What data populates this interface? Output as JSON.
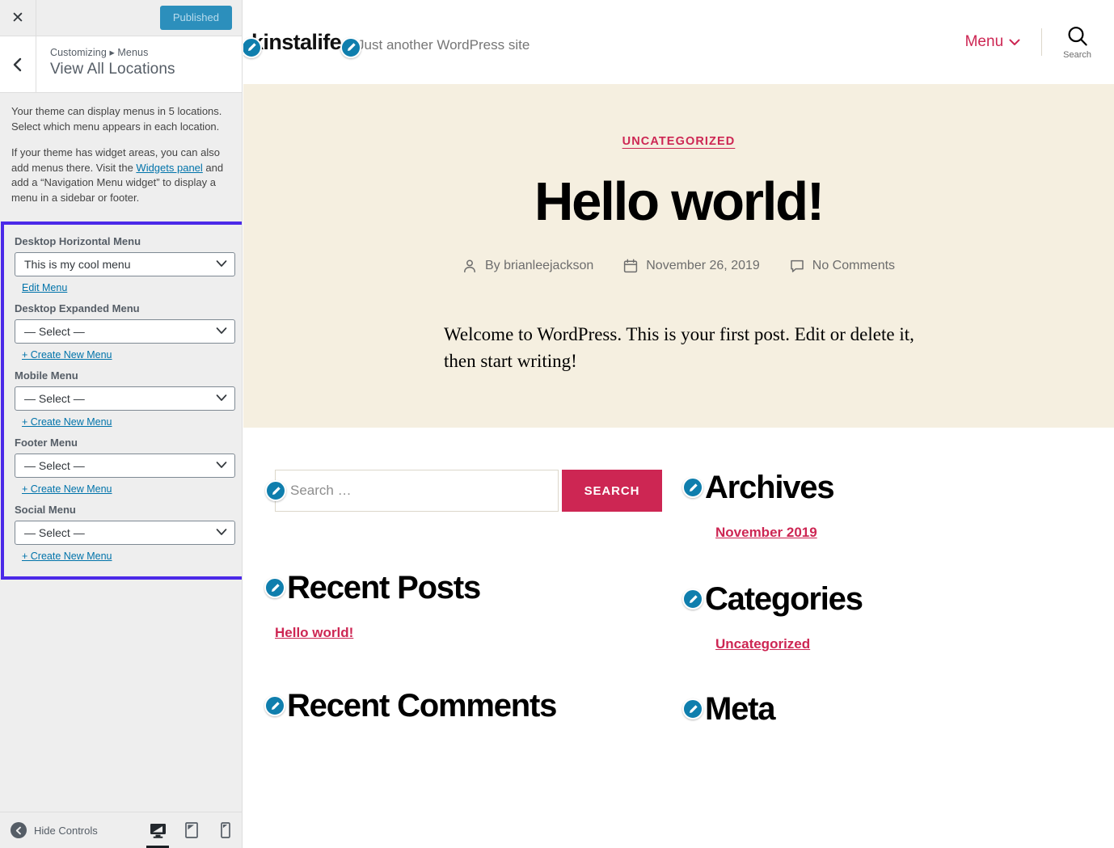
{
  "customizer": {
    "close_icon": "close-x-icon",
    "publish_button": "Published",
    "back_icon": "chevron-left-icon",
    "breadcrumb": "Customizing ▸ Menus",
    "panel_title": "View All Locations",
    "intro_paragraph_1": "Your theme can display menus in 5 locations. Select which menu appears in each location.",
    "intro_paragraph_2_before": "If your theme has widget areas, you can also add menus there. Visit the ",
    "intro_link": "Widgets panel",
    "intro_paragraph_2_after": " and add a “Navigation Menu widget” to display a menu in a sidebar or footer.",
    "highlight_color": "#4b29e8",
    "locations": [
      {
        "label": "Desktop Horizontal Menu",
        "selected": "This is my cool menu",
        "action_link": "Edit Menu"
      },
      {
        "label": "Desktop Expanded Menu",
        "selected": "— Select —",
        "action_link": "+ Create New Menu"
      },
      {
        "label": "Mobile Menu",
        "selected": "— Select —",
        "action_link": "+ Create New Menu"
      },
      {
        "label": "Footer Menu",
        "selected": "— Select —",
        "action_link": "+ Create New Menu"
      },
      {
        "label": "Social Menu",
        "selected": "— Select —",
        "action_link": "+ Create New Menu"
      }
    ],
    "footer": {
      "hide_controls": "Hide Controls",
      "devices": [
        {
          "name": "desktop-preview",
          "icon": "desktop-icon",
          "active": true
        },
        {
          "name": "tablet-preview",
          "icon": "tablet-icon",
          "active": false
        },
        {
          "name": "mobile-preview",
          "icon": "mobile-icon",
          "active": false
        }
      ]
    }
  },
  "preview": {
    "header": {
      "site_title": "kinstalife",
      "tagline": "Just another WordPress site",
      "menu_label": "Menu",
      "menu_chevron": "chevron-down-icon",
      "search_label": "Search",
      "search_icon": "search-icon",
      "accent_color": "#cd2653"
    },
    "hero": {
      "background_color": "#f5efe0",
      "category": "UNCATEGORIZED",
      "title": "Hello world!",
      "meta": {
        "author_icon": "person-icon",
        "author": "By brianleejackson",
        "date_icon": "calendar-icon",
        "date": "November 26, 2019",
        "comments_icon": "comment-icon",
        "comments": "No Comments"
      },
      "body": "Welcome to WordPress. This is your first post. Edit or delete it, then start writing!"
    },
    "widgets": {
      "search": {
        "placeholder": "Search …",
        "value": "",
        "button": "SEARCH",
        "button_color": "#cd2653"
      },
      "recent_posts": {
        "title": "Recent Posts",
        "items": [
          "Hello world!"
        ]
      },
      "recent_comments": {
        "title": "Recent Comments",
        "items": []
      },
      "archives": {
        "title": "Archives",
        "items": [
          "November 2019"
        ]
      },
      "categories": {
        "title": "Categories",
        "items": [
          "Uncategorized"
        ]
      },
      "meta": {
        "title": "Meta",
        "items": []
      }
    },
    "edit_icon_name": "edit-pencil-icon"
  }
}
